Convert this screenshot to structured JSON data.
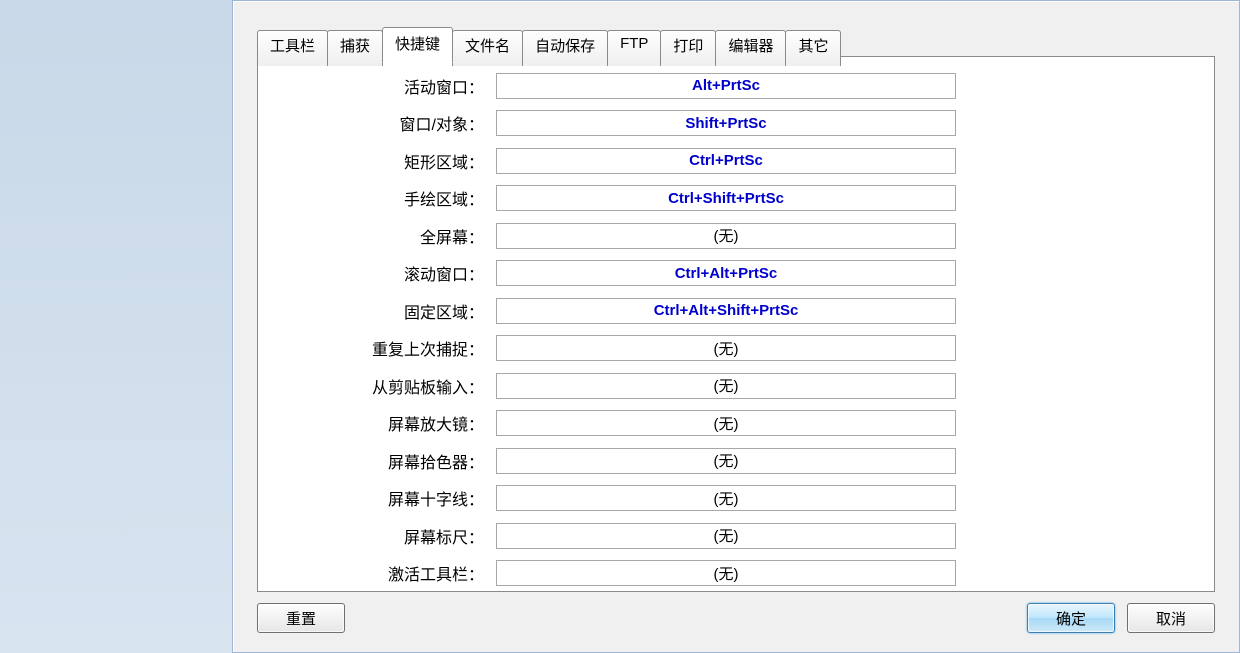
{
  "tabs": [
    {
      "label": "工具栏"
    },
    {
      "label": "捕获"
    },
    {
      "label": "快捷键"
    },
    {
      "label": "文件名"
    },
    {
      "label": "自动保存"
    },
    {
      "label": "FTP"
    },
    {
      "label": "打印"
    },
    {
      "label": "编辑器"
    },
    {
      "label": "其它"
    }
  ],
  "active_tab_index": 2,
  "hotkeys": [
    {
      "label": "活动窗口：",
      "value": "Alt+PrtSc",
      "is_none": false
    },
    {
      "label": "窗口/对象：",
      "value": "Shift+PrtSc",
      "is_none": false
    },
    {
      "label": "矩形区域：",
      "value": "Ctrl+PrtSc",
      "is_none": false
    },
    {
      "label": "手绘区域：",
      "value": "Ctrl+Shift+PrtSc",
      "is_none": false
    },
    {
      "label": "全屏幕：",
      "value": "(无)",
      "is_none": true
    },
    {
      "label": "滚动窗口：",
      "value": "Ctrl+Alt+PrtSc",
      "is_none": false
    },
    {
      "label": "固定区域：",
      "value": "Ctrl+Alt+Shift+PrtSc",
      "is_none": false
    },
    {
      "label": "重复上次捕捉：",
      "value": "(无)",
      "is_none": true
    },
    {
      "label": "从剪贴板输入：",
      "value": "(无)",
      "is_none": true
    },
    {
      "label": "屏幕放大镜：",
      "value": "(无)",
      "is_none": true
    },
    {
      "label": "屏幕拾色器：",
      "value": "(无)",
      "is_none": true
    },
    {
      "label": "屏幕十字线：",
      "value": "(无)",
      "is_none": true
    },
    {
      "label": "屏幕标尺：",
      "value": "(无)",
      "is_none": true
    },
    {
      "label": "激活工具栏：",
      "value": "(无)",
      "is_none": true
    }
  ],
  "buttons": {
    "reset": "重置",
    "ok": "确定",
    "cancel": "取消"
  }
}
